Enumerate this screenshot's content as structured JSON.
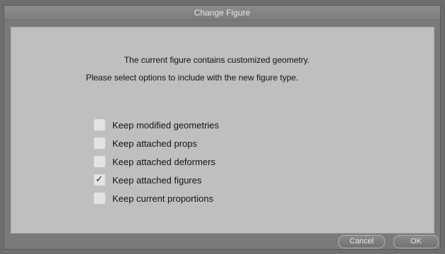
{
  "window": {
    "title": "Change Figure"
  },
  "message": {
    "line1": "The current figure contains customized geometry.",
    "line2": "Please select options to include with the new figure type."
  },
  "options": [
    {
      "label": "Keep modified geometries",
      "checked": false
    },
    {
      "label": "Keep attached props",
      "checked": false
    },
    {
      "label": "Keep attached deformers",
      "checked": false
    },
    {
      "label": "Keep attached figures",
      "checked": true
    },
    {
      "label": "Keep current proportions",
      "checked": false
    }
  ],
  "buttons": {
    "cancel_label": "Cancel",
    "ok_label": "OK"
  },
  "icons": {
    "check": "checkmark-icon"
  }
}
